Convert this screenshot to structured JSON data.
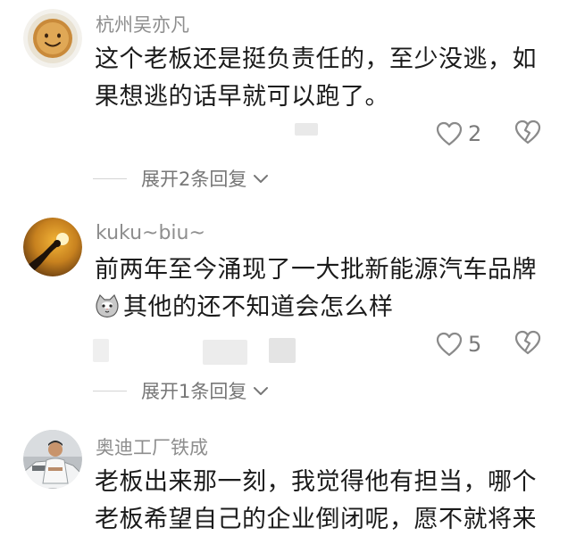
{
  "comments": [
    {
      "user": "杭州吴亦凡",
      "lines": [
        "这个老板还是挺负责任的，至少没逃，如",
        "果想逃的话早就可以跑了。"
      ],
      "likes": "2",
      "replies_label": "展开2条回复",
      "avatar_icon": "smiley-bun-icon"
    },
    {
      "user": "kuku~biu~",
      "lines": [
        "前两年至今涌现了一大批新能源汽车品牌",
        "其他的还不知道会怎么样"
      ],
      "likes": "5",
      "replies_label": "展开1条回复",
      "avatar_icon": "sunset-hand-icon",
      "emoji": "cat-face-emoji"
    },
    {
      "user": "奥迪工厂铁成",
      "lines": [
        "老板出来那一刻，我觉得他有担当，哪个",
        "老板希望自己的企业倒闭呢，愿不就将来"
      ],
      "avatar_icon": "man-with-car-icon"
    }
  ],
  "colors": {
    "username": "#8e8e8e",
    "text": "#1b1b1b",
    "icon": "#8a8a8a",
    "meta": "#777777"
  }
}
